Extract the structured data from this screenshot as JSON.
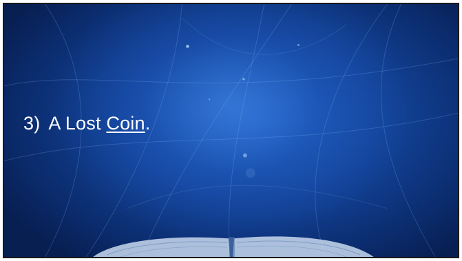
{
  "slide": {
    "number_label": "3)",
    "text_before": "A Lost ",
    "underlined_word": "Coin",
    "text_after": "."
  },
  "colors": {
    "background_center": "#1f5fc0",
    "background_edge": "#081f52",
    "text": "#ffffff"
  }
}
